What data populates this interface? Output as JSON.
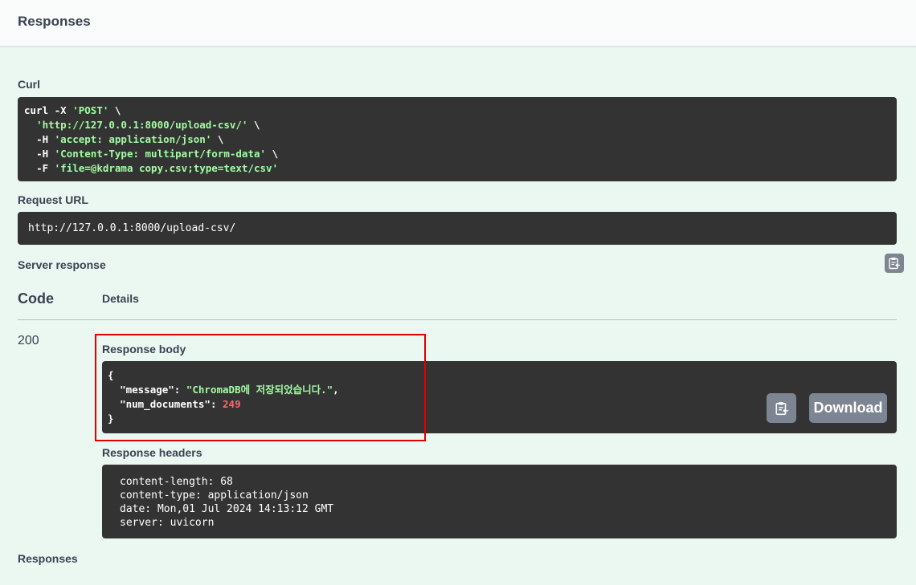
{
  "header": {
    "title": "Responses"
  },
  "curl": {
    "label": "Curl",
    "line1_cmd": "curl -X ",
    "line1_method": "'POST'",
    "line1_cont": " \\",
    "line2_url": "'http://127.0.0.1:8000/upload-csv/'",
    "line2_cont": " \\",
    "line3_flag": "-H ",
    "line3_val": "'accept: application/json'",
    "line3_cont": " \\",
    "line4_flag": "-H ",
    "line4_val": "'Content-Type: multipart/form-data'",
    "line4_cont": " \\",
    "line5_flag": "-F ",
    "line5_val": "'file=@kdrama copy.csv;type=text/csv'"
  },
  "request_url": {
    "label": "Request URL",
    "value": "http://127.0.0.1:8000/upload-csv/"
  },
  "server_response": {
    "label": "Server response",
    "col_code": "Code",
    "col_details": "Details",
    "status_code": "200",
    "body_label": "Response body",
    "body": {
      "open": "{",
      "message_key": "\"message\"",
      "message_value": "\"ChromaDB에 저장되었습니다.\"",
      "num_key": "\"num_documents\"",
      "num_value": "249",
      "close": "}"
    },
    "download_label": "Download",
    "headers_label": "Response headers",
    "headers": [
      "content-length: 68",
      "content-type: application/json",
      "date: Mon,01 Jul 2024 14:13:12 GMT",
      "server: uvicorn"
    ]
  },
  "footer_label": "Responses",
  "icons": {
    "copy": "clipboard-copy-icon"
  },
  "colors": {
    "string": "#a2fca2",
    "number": "#fc6868",
    "highlight": "#e00000",
    "button": "#7d8492"
  }
}
